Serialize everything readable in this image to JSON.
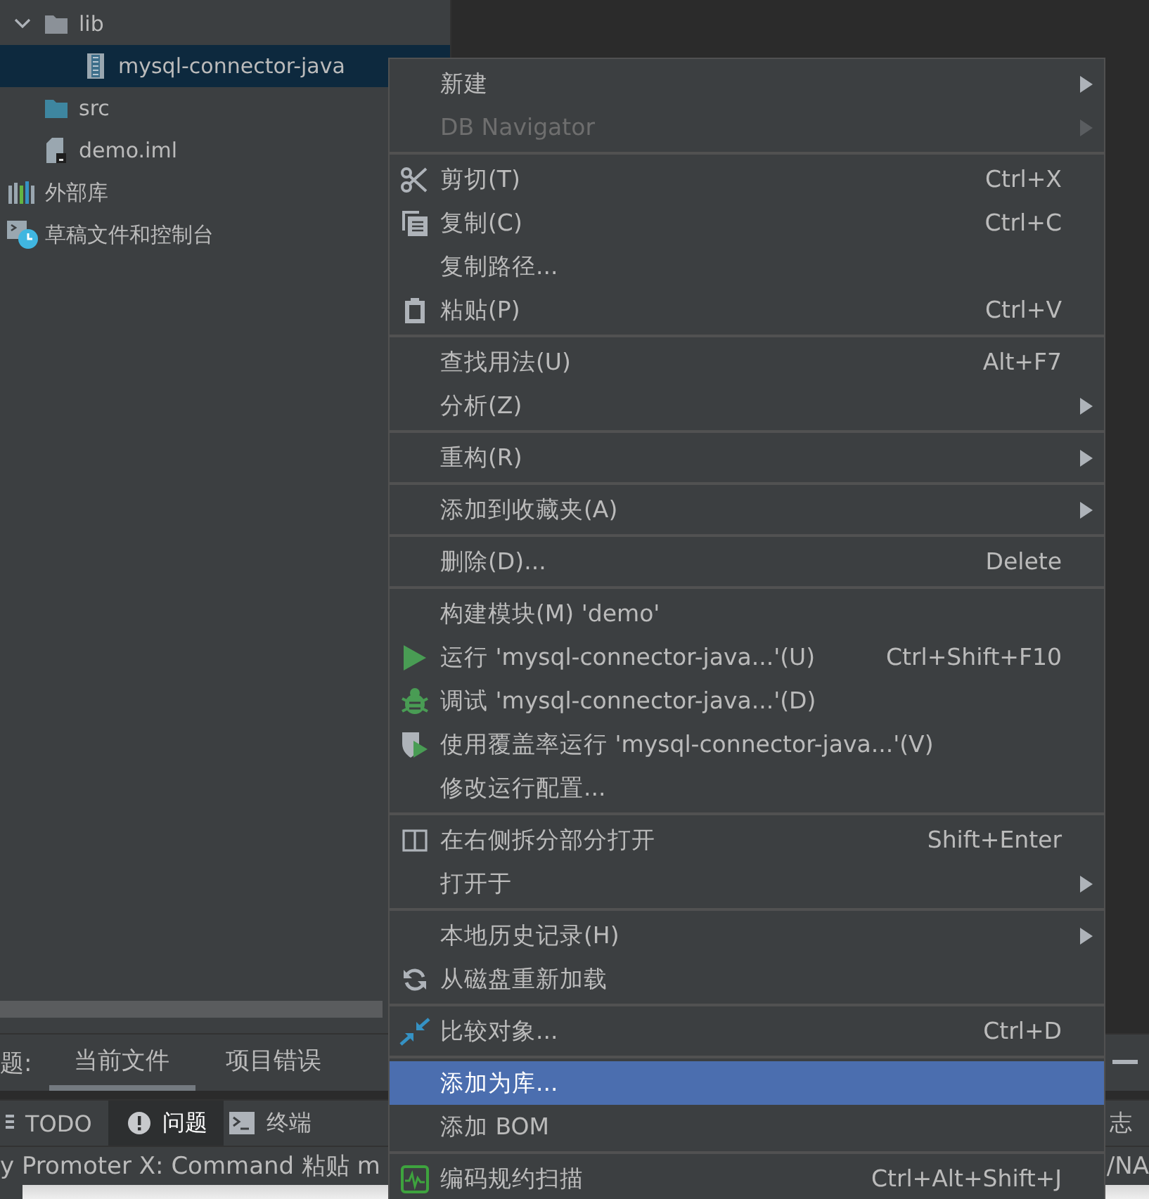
{
  "tree": {
    "partial_children": [
      {
        "label": "lib",
        "kind": "folder",
        "expanded": true,
        "selected": false,
        "children": [
          {
            "label": "mysql-connector-java",
            "kind": "jar",
            "selected": true
          }
        ]
      },
      {
        "label": "src",
        "kind": "source",
        "selected": false
      },
      {
        "label": "demo.iml",
        "kind": "file",
        "selected": false
      }
    ],
    "items": [
      {
        "label": "外部库",
        "kind": "libraries",
        "selected": false
      },
      {
        "label": "草稿文件和控制台",
        "kind": "scratches",
        "selected": false
      }
    ]
  },
  "problems_bar": {
    "label": "题:",
    "tabs": [
      {
        "label": "当前文件",
        "selected": true
      },
      {
        "label": "项目错误",
        "selected": false
      }
    ],
    "minimize": true
  },
  "tool_windows": [
    {
      "label": "TODO",
      "kind": "todo",
      "selected": false
    },
    {
      "label": "问题",
      "kind": "problems",
      "selected": true
    },
    {
      "label": "终端",
      "kind": "terminal",
      "selected": false
    }
  ],
  "tool_windows_right": "志",
  "status_bar": {
    "text": "y Promoter X: Command 粘贴 m",
    "right": "/NA"
  },
  "context_menu": [
    [
      {
        "label": "新建",
        "kind": "plain",
        "submenu": true,
        "disabled": false,
        "selected": false
      },
      {
        "label": "DB Navigator",
        "kind": "plain",
        "submenu": true,
        "disabled": true,
        "selected": false
      }
    ],
    [
      {
        "label": "剪切(T)",
        "kind": "cut",
        "shortcut": "Ctrl+X",
        "submenu": false,
        "disabled": false,
        "selected": false
      },
      {
        "label": "复制(C)",
        "kind": "copy",
        "shortcut": "Ctrl+C",
        "submenu": false,
        "disabled": false,
        "selected": false
      },
      {
        "label": "复制路径...",
        "kind": "plain",
        "submenu": false,
        "disabled": false,
        "selected": false
      },
      {
        "label": "粘贴(P)",
        "kind": "paste",
        "shortcut": "Ctrl+V",
        "submenu": false,
        "disabled": false,
        "selected": false
      }
    ],
    [
      {
        "label": "查找用法(U)",
        "kind": "plain",
        "shortcut": "Alt+F7",
        "submenu": false,
        "disabled": false,
        "selected": false
      },
      {
        "label": "分析(Z)",
        "kind": "plain",
        "submenu": true,
        "disabled": false,
        "selected": false
      }
    ],
    [
      {
        "label": "重构(R)",
        "kind": "plain",
        "submenu": true,
        "disabled": false,
        "selected": false
      }
    ],
    [
      {
        "label": "添加到收藏夹(A)",
        "kind": "plain",
        "submenu": true,
        "disabled": false,
        "selected": false
      }
    ],
    [
      {
        "label": "删除(D)...",
        "kind": "plain",
        "shortcut": "Delete",
        "submenu": false,
        "disabled": false,
        "selected": false
      }
    ],
    [
      {
        "label": "构建模块(M) 'demo'",
        "kind": "plain",
        "submenu": false,
        "disabled": false,
        "selected": false
      },
      {
        "label": "运行 'mysql-connector-java...'(U)",
        "kind": "run",
        "shortcut": "Ctrl+Shift+F10",
        "submenu": false,
        "disabled": false,
        "selected": false
      },
      {
        "label": "调试 'mysql-connector-java...'(D)",
        "kind": "debug",
        "submenu": false,
        "disabled": false,
        "selected": false
      },
      {
        "label": "使用覆盖率运行  'mysql-connector-java...'(V)",
        "kind": "coverage",
        "submenu": false,
        "disabled": false,
        "selected": false
      },
      {
        "label": "修改运行配置...",
        "kind": "plain",
        "submenu": false,
        "disabled": false,
        "selected": false
      }
    ],
    [
      {
        "label": "在右侧拆分部分打开",
        "kind": "split",
        "shortcut": "Shift+Enter",
        "submenu": false,
        "disabled": false,
        "selected": false
      },
      {
        "label": "打开于",
        "kind": "plain",
        "submenu": true,
        "disabled": false,
        "selected": false
      }
    ],
    [
      {
        "label": "本地历史记录(H)",
        "kind": "plain",
        "submenu": true,
        "disabled": false,
        "selected": false
      },
      {
        "label": "从磁盘重新加载",
        "kind": "reload",
        "submenu": false,
        "disabled": false,
        "selected": false
      }
    ],
    [
      {
        "label": "比较对象...",
        "kind": "compare",
        "shortcut": "Ctrl+D",
        "submenu": false,
        "disabled": false,
        "selected": false
      }
    ],
    [
      {
        "label": "添加为库...",
        "kind": "plain",
        "submenu": false,
        "disabled": false,
        "selected": true
      },
      {
        "label": "添加 BOM",
        "kind": "plain",
        "submenu": false,
        "disabled": false,
        "selected": false
      }
    ],
    [
      {
        "label": "编码规约扫描",
        "kind": "scan",
        "shortcut": "Ctrl+Alt+Shift+J",
        "submenu": false,
        "disabled": false,
        "selected": false
      }
    ]
  ]
}
